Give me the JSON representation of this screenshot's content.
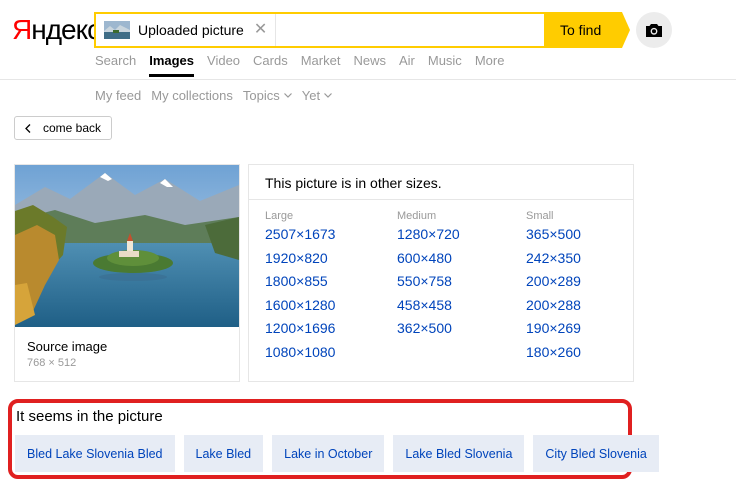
{
  "logo": {
    "first_letter": "Я",
    "rest": "ндекс"
  },
  "search": {
    "chip_label": "Uploaded picture",
    "close_glyph": "✕",
    "find_label": "To find"
  },
  "tabs": [
    {
      "label": "Search",
      "active": false
    },
    {
      "label": "Images",
      "active": true
    },
    {
      "label": "Video",
      "active": false
    },
    {
      "label": "Cards",
      "active": false
    },
    {
      "label": "Market",
      "active": false
    },
    {
      "label": "News",
      "active": false
    },
    {
      "label": "Air",
      "active": false
    },
    {
      "label": "Music",
      "active": false
    },
    {
      "label": "More",
      "active": false
    }
  ],
  "subtabs": [
    {
      "label": "My feed"
    },
    {
      "label": "My collections"
    },
    {
      "label": "Topics"
    },
    {
      "label": "Yet"
    }
  ],
  "back": {
    "label": "come back"
  },
  "source": {
    "title": "Source image",
    "dimensions": "768 × 512"
  },
  "sizes": {
    "title": "This picture is in other sizes.",
    "columns": [
      {
        "heading": "Large",
        "items": [
          "2507×1673",
          "1920×820",
          "1800×855",
          "1600×1280",
          "1200×1696",
          "1080×1080"
        ]
      },
      {
        "heading": "Medium",
        "items": [
          "1280×720",
          "600×480",
          "550×758",
          "458×458",
          "362×500"
        ]
      },
      {
        "heading": "Small",
        "items": [
          "365×500",
          "242×350",
          "200×289",
          "200×288",
          "190×269",
          "180×260"
        ]
      }
    ]
  },
  "related": {
    "title": "It seems in the picture",
    "chips": [
      "Bled Lake Slovenia Bled",
      "Lake Bled",
      "Lake in October",
      "Lake Bled Slovenia",
      "City Bled Slovenia"
    ]
  },
  "colors": {
    "accent_yellow": "#ffcc00",
    "link_blue": "#0044bb",
    "highlight_red": "#e02020",
    "logo_red": "#ff0000"
  },
  "icons": {
    "camera": "camera-icon",
    "back": "chevron-left-icon",
    "close": "close-icon",
    "dropdown": "chevron-down-icon"
  }
}
